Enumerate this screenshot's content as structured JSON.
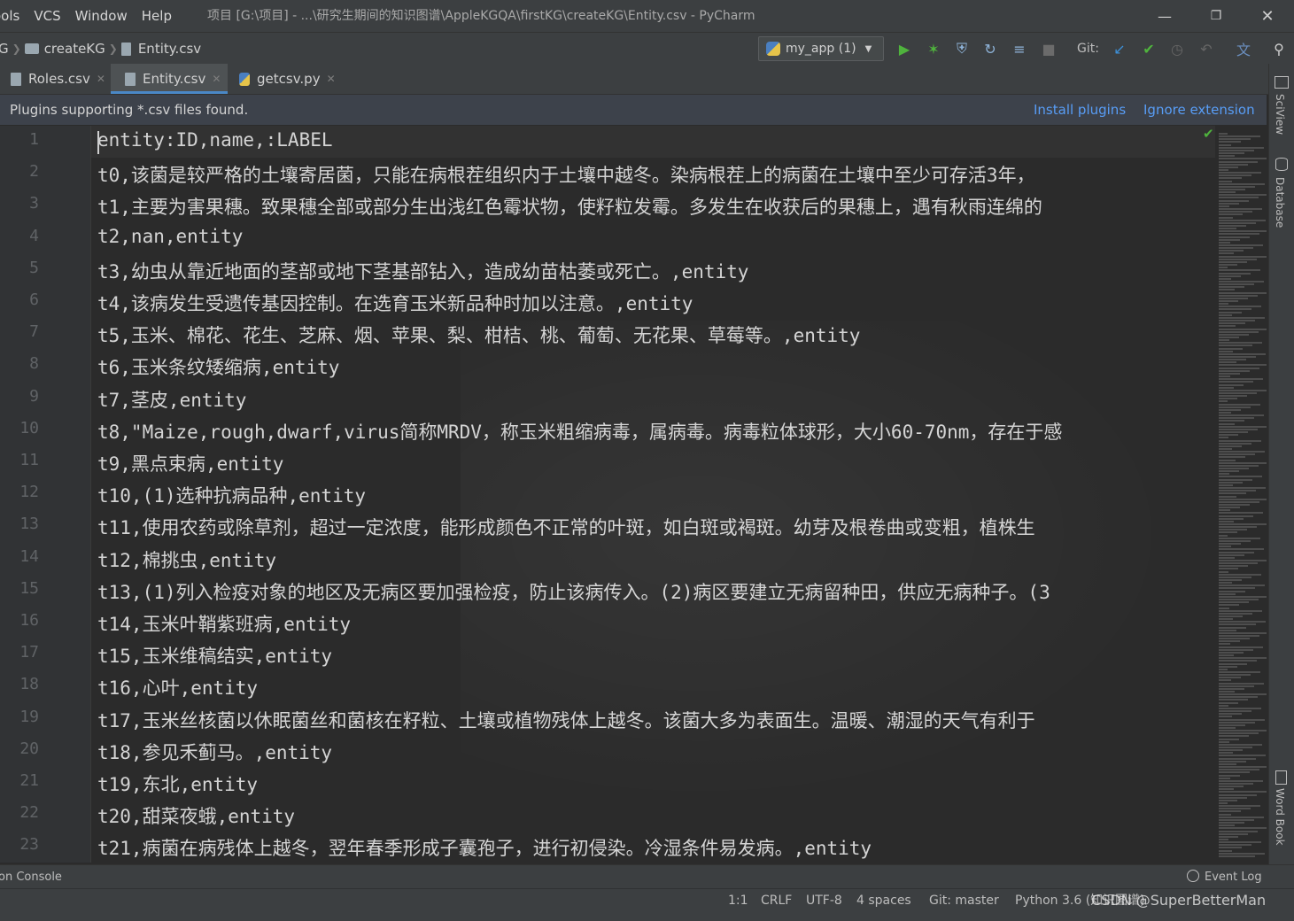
{
  "menu": [
    "ools",
    "VCS",
    "Window",
    "Help"
  ],
  "window_title": "项目 [G:\\项目] - ...\\研究生期间的知识图谱\\AppleKGQA\\firstKG\\createKG\\Entity.csv - PyCharm",
  "breadcrumb": {
    "prefix": "G",
    "folder": "createKG",
    "file": "Entity.csv"
  },
  "run_config": "my_app (1)",
  "git_label": "Git:",
  "tabs": [
    {
      "label": "Roles.csv"
    },
    {
      "label": "Entity.csv"
    },
    {
      "label": "getcsv.py"
    }
  ],
  "banner": {
    "text": "Plugins supporting *.csv files found.",
    "install": "Install plugins",
    "ignore": "Ignore extension"
  },
  "lines": [
    "entity:ID,name,:LABEL",
    "t0,该菌是较严格的土壤寄居菌，只能在病根茬组织内于土壤中越冬。染病根茬上的病菌在土壤中至少可存活3年，",
    "t1,主要为害果穗。致果穗全部或部分生出浅红色霉状物，使籽粒发霉。多发生在收获后的果穗上，遇有秋雨连绵的",
    "t2,nan,entity",
    "t3,幼虫从靠近地面的茎部或地下茎基部钻入，造成幼苗枯萎或死亡。,entity",
    "t4,该病发生受遗传基因控制。在选育玉米新品种时加以注意。,entity",
    "t5,玉米、棉花、花生、芝麻、烟、苹果、梨、柑桔、桃、葡萄、无花果、草莓等。,entity",
    "t6,玉米条纹矮缩病,entity",
    "t7,茎皮,entity",
    "t8,\"Maize,rough,dwarf,virus简称MRDV，称玉米粗缩病毒，属病毒。病毒粒体球形，大小60-70nm，存在于感",
    "t9,黑点束病,entity",
    "t10,(1)选种抗病品种,entity",
    "t11,使用农药或除草剂，超过一定浓度，能形成颜色不正常的叶斑，如白斑或褐斑。幼芽及根卷曲或变粗，植株生",
    "t12,棉挑虫,entity",
    "t13,(1)列入检疫对象的地区及无病区要加强检疫，防止该病传入。(2)病区要建立无病留种田，供应无病种子。(3",
    "t14,玉米叶鞘紫班病,entity",
    "t15,玉米维稿结实,entity",
    "t16,心叶,entity",
    "t17,玉米丝核菌以休眠菌丝和菌核在籽粒、土壤或植物残体上越冬。该菌大多为表面生。温暖、潮湿的天气有利于",
    "t18,参见禾蓟马。,entity",
    "t19,东北,entity",
    "t20,甜菜夜蛾,entity",
    "t21,病菌在病残体上越冬，翌年春季形成子囊孢子，进行初侵染。冷湿条件易发病。,entity"
  ],
  "line_numbers": [
    "1",
    "2",
    "3",
    "4",
    "5",
    "6",
    "7",
    "8",
    "9",
    "10",
    "11",
    "12",
    "13",
    "14",
    "15",
    "16",
    "17",
    "18",
    "19",
    "20",
    "21",
    "22",
    "23"
  ],
  "right_tools": [
    "SciView",
    "Database",
    "Word Book"
  ],
  "bottom_tools": {
    "left": "on Console",
    "right": "Event Log"
  },
  "status": {
    "position": "1:1",
    "line_sep": "CRLF",
    "encoding": "UTF-8",
    "indent": "4 spaces",
    "git": "Git: master",
    "interpreter": "Python 3.6 (知识图谱)"
  },
  "watermark_text": "CSDN @SuperBetterMan",
  "colors": {
    "accent": "#4a88c7",
    "link": "#589df6",
    "run_green": "#4fb33d"
  }
}
